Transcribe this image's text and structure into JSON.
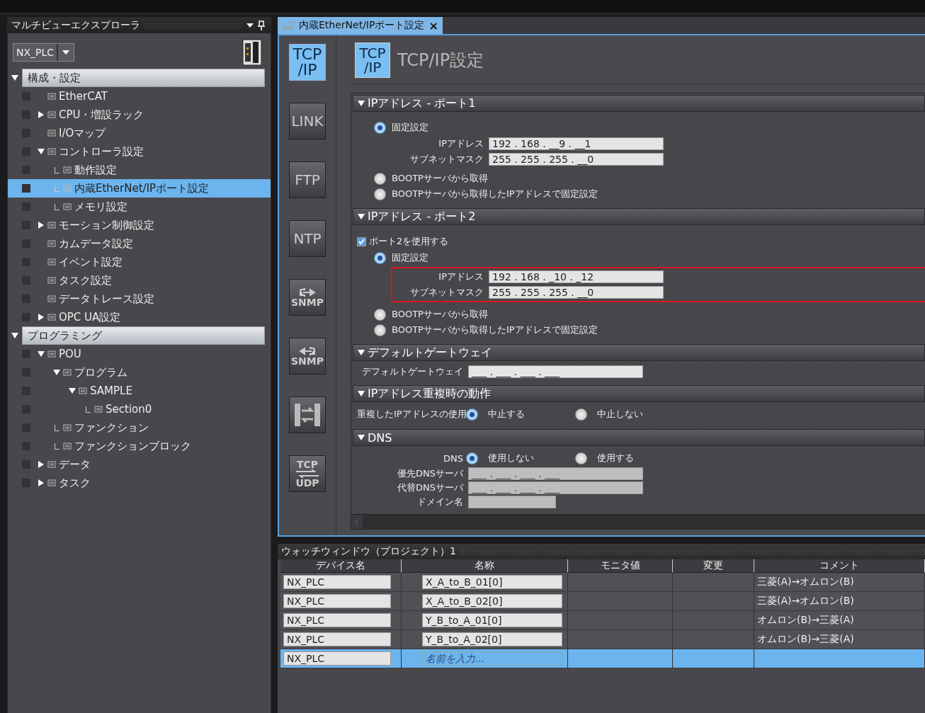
{
  "explorer": {
    "title": "マルチビューエクスプローラ",
    "device": "NX_PLC",
    "groups": [
      {
        "label": "構成・設定",
        "expanded": true,
        "items": [
          {
            "label": "EtherCAT",
            "selected": false
          },
          {
            "label": "CPU・増設ラック",
            "selected": false,
            "expanded": false
          },
          {
            "label": "I/Oマップ",
            "selected": false
          },
          {
            "label": "コントローラ設定",
            "selected": false,
            "expanded": true,
            "children": [
              {
                "label": "動作設定",
                "selected": false
              },
              {
                "label": "内蔵EtherNet/IPポート設定",
                "selected": true
              },
              {
                "label": "メモリ設定",
                "selected": false
              }
            ]
          },
          {
            "label": "モーション制御設定",
            "selected": false,
            "expanded": false
          },
          {
            "label": "カムデータ設定",
            "selected": false
          },
          {
            "label": "イベント設定",
            "selected": false
          },
          {
            "label": "タスク設定",
            "selected": false
          },
          {
            "label": "データトレース設定",
            "selected": false
          },
          {
            "label": "OPC UA設定",
            "selected": false,
            "expanded": false
          }
        ]
      },
      {
        "label": "プログラミング",
        "expanded": true,
        "items": [
          {
            "label": "POU",
            "selected": false,
            "expanded": true,
            "children": [
              {
                "label": "プログラム",
                "selected": false,
                "expanded": true,
                "children": [
                  {
                    "label": "SAMPLE",
                    "selected": false,
                    "expanded": true,
                    "children": [
                      {
                        "label": "Section0",
                        "selected": false
                      }
                    ]
                  }
                ]
              },
              {
                "label": "ファンクション",
                "selected": false
              },
              {
                "label": "ファンクションブロック",
                "selected": false
              }
            ]
          },
          {
            "label": "データ",
            "selected": false,
            "expanded": false
          },
          {
            "label": "タスク",
            "selected": false,
            "expanded": false
          }
        ]
      }
    ]
  },
  "editor_tab": {
    "label": "内蔵EtherNet/IPポート設定",
    "close": "×",
    "selected": true
  },
  "nav": [
    {
      "kind": "text",
      "lines": [
        "TCP",
        "/IP"
      ],
      "selected": true
    },
    {
      "kind": "text",
      "lines": [
        "LINK"
      ],
      "selected": false
    },
    {
      "kind": "text",
      "lines": [
        "FTP"
      ],
      "selected": false
    },
    {
      "kind": "text",
      "lines": [
        "NTP"
      ],
      "selected": false
    },
    {
      "kind": "snmp-out",
      "lines": [
        "SNMP"
      ],
      "selected": false
    },
    {
      "kind": "snmp-in",
      "lines": [
        "SNMP"
      ],
      "selected": false
    },
    {
      "kind": "io",
      "selected": false
    },
    {
      "kind": "tcpudp",
      "lines": [
        "TCP",
        "UDP"
      ],
      "selected": false
    }
  ],
  "header": {
    "icon_lines": [
      "TCP",
      "/IP"
    ],
    "title": "TCP/IP設定"
  },
  "sections": [
    {
      "title": "IPアドレス - ポート1",
      "rows": [
        {
          "kind": "radio",
          "label": "固定設定",
          "selected": true,
          "fields": [
            {
              "label": "IPアドレス",
              "value": "192 . 168 . __9 . __1",
              "disabled": false
            },
            {
              "label": "サブネットマスク",
              "value": "255 . 255 . 255 . __0",
              "disabled": false
            }
          ]
        },
        {
          "kind": "radio",
          "label": "BOOTPサーバから取得",
          "selected": false
        },
        {
          "kind": "radio",
          "label": "BOOTPサーバから取得したIPアドレスで固定設定",
          "selected": false
        }
      ]
    },
    {
      "title": "IPアドレス - ポート2",
      "highlight": true,
      "rows": [
        {
          "kind": "checkbox",
          "label": "ポート2を使用する",
          "checked": true
        },
        {
          "kind": "radio",
          "label": "固定設定",
          "selected": true,
          "fields": [
            {
              "label": "IPアドレス",
              "value": "192 . 168 . _10 . _12",
              "disabled": false
            },
            {
              "label": "サブネットマスク",
              "value": "255 . 255 . 255 . __0",
              "disabled": false
            }
          ]
        },
        {
          "kind": "radio",
          "label": "BOOTPサーバから取得",
          "selected": false
        },
        {
          "kind": "radio",
          "label": "BOOTPサーバから取得したIPアドレスで固定設定",
          "selected": false
        }
      ]
    },
    {
      "title": "デフォルトゲートウェイ",
      "rows": [
        {
          "kind": "field",
          "label": "デフォルトゲートウェイ",
          "value": "___ . ___ . ___ . ___",
          "disabled": false
        }
      ]
    },
    {
      "title": "IPアドレス重複時の動作",
      "rows": [
        {
          "kind": "choice",
          "label": "重複したIPアドレスの使用",
          "options": [
            {
              "label": "中止する",
              "selected": true
            },
            {
              "label": "中止しない",
              "selected": false
            }
          ]
        }
      ]
    },
    {
      "title": "DNS",
      "rows": [
        {
          "kind": "choice",
          "label": "DNS",
          "options": [
            {
              "label": "使用しない",
              "selected": true
            },
            {
              "label": "使用する",
              "selected": false
            }
          ]
        },
        {
          "kind": "field",
          "label": "優先DNSサーバ",
          "value": "___ . ___ . ___ . ___",
          "disabled": true
        },
        {
          "kind": "field",
          "label": "代替DNSサーバ",
          "value": "___ . ___ . ___ . ___",
          "disabled": true
        },
        {
          "kind": "field",
          "label": "ドメイン名",
          "disabled": true
        }
      ]
    }
  ],
  "watch": {
    "title": "ウォッチウィンドウ（プロジェクト）1",
    "columns": [
      "デバイス名",
      "名称",
      "モニタ値",
      "変更",
      "コメント"
    ],
    "rows": [
      {
        "device": "NX_PLC",
        "name": "X_A_to_B_01[0]",
        "comment": "三菱(A)→オムロン(B)",
        "selected": false
      },
      {
        "device": "NX_PLC",
        "name": "X_A_to_B_02[0]",
        "comment": "三菱(A)→オムロン(B)",
        "selected": false
      },
      {
        "device": "NX_PLC",
        "name": "Y_B_to_A_01[0]",
        "comment": "オムロン(B)→三菱(A)",
        "selected": false
      },
      {
        "device": "NX_PLC",
        "name": "Y_B_to_A_02[0]",
        "comment": "オムロン(B)→三菱(A)",
        "selected": false
      },
      {
        "device": "NX_PLC",
        "placeholder": "名前を入力...",
        "selected": true
      }
    ]
  }
}
